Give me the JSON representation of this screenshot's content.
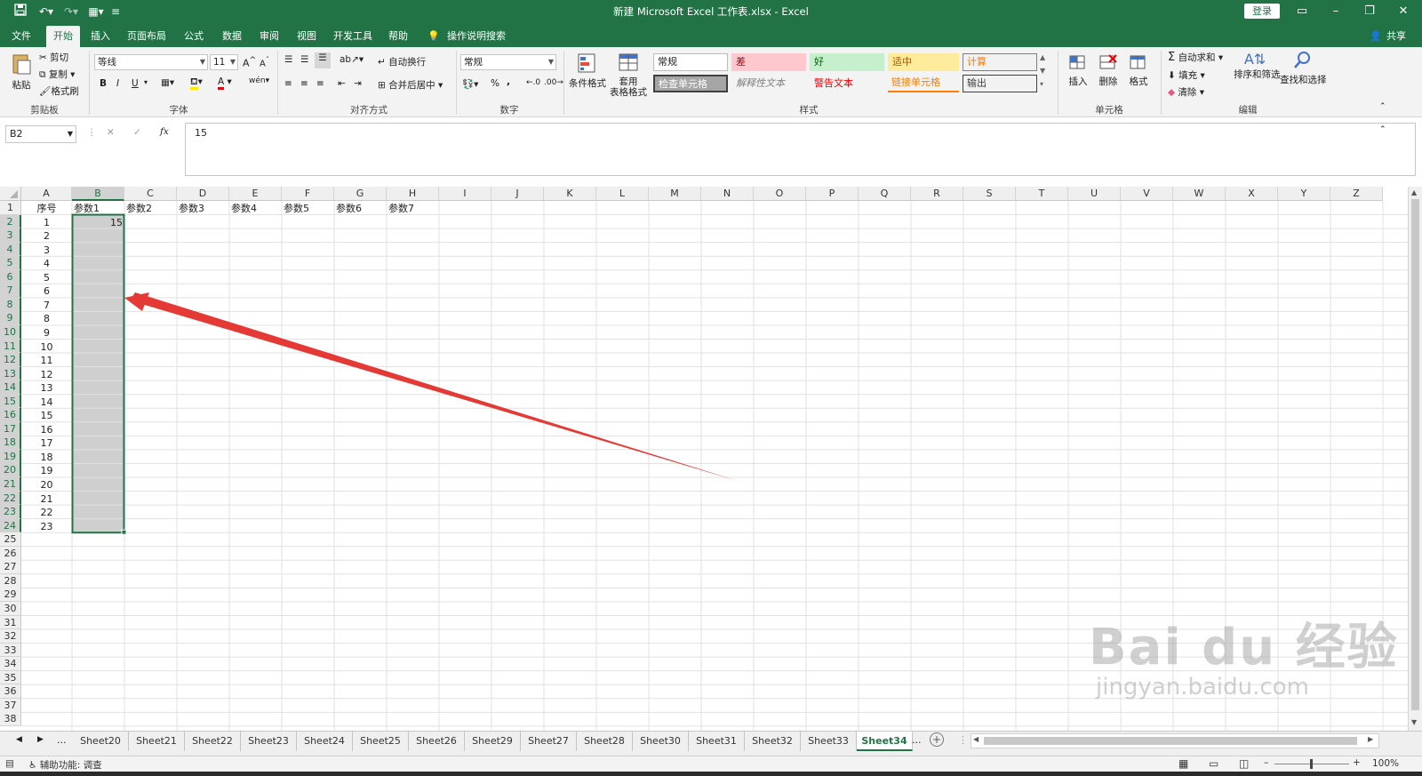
{
  "titlebar": {
    "title": "新建 Microsoft Excel 工作表.xlsx  -  Excel",
    "login": "登录",
    "quick_access": [
      "save-icon",
      "undo-icon",
      "redo-icon",
      "form-icon",
      "customize-icon"
    ]
  },
  "tabs": [
    "文件",
    "开始",
    "插入",
    "页面布局",
    "公式",
    "数据",
    "审阅",
    "视图",
    "开发工具",
    "帮助",
    "操作说明搜索"
  ],
  "active_tab": "开始",
  "share": "共享",
  "ribbon": {
    "clipboard": {
      "paste": "粘贴",
      "cut": "剪切",
      "copy": "复制",
      "format_painter": "格式刷",
      "label": "剪贴板"
    },
    "font": {
      "name": "等线",
      "size": "11",
      "bold": "B",
      "italic": "I",
      "underline": "U",
      "font_color": "A",
      "phonetic": "wén",
      "label": "字体"
    },
    "alignment": {
      "wrap": "自动换行",
      "merge": "合并后居中",
      "label": "对齐方式"
    },
    "number": {
      "format": "常规",
      "percent": "%",
      "comma": ",",
      "label": "数字"
    },
    "styles": {
      "conditional": "条件格式",
      "table_1": "套用",
      "table_2": "表格格式",
      "cells": [
        "常规",
        "差",
        "好",
        "适中",
        "计算",
        "检查单元格",
        "解释性文本",
        "警告文本",
        "链接单元格",
        "输出"
      ],
      "label": "样式"
    },
    "cells_group": {
      "insert": "插入",
      "delete": "删除",
      "format": "格式",
      "label": "单元格"
    },
    "editing": {
      "autosum": "自动求和",
      "fill": "填充",
      "clear": "清除",
      "sort": "排序和筛选",
      "find": "查找和选择",
      "label": "编辑"
    }
  },
  "formula_bar": {
    "name_box": "B2",
    "fx": "fx",
    "value": "15"
  },
  "columns": [
    "A",
    "B",
    "C",
    "D",
    "E",
    "F",
    "G",
    "H",
    "I",
    "J",
    "K",
    "L",
    "M",
    "N",
    "O",
    "P",
    "Q",
    "R",
    "S",
    "T",
    "U",
    "V",
    "W",
    "X",
    "Y",
    "Z"
  ],
  "rows": [
    "1",
    "2",
    "3",
    "4",
    "5",
    "6",
    "7",
    "8",
    "9",
    "10",
    "11",
    "12",
    "13",
    "14",
    "15",
    "16",
    "17",
    "18",
    "19",
    "20",
    "21",
    "22",
    "23",
    "24",
    "25",
    "26",
    "27",
    "28",
    "29",
    "30",
    "31",
    "32",
    "33",
    "34",
    "35",
    "36",
    "37",
    "38"
  ],
  "header_row": [
    "序号",
    "参数1",
    "参数2",
    "参数3",
    "参数4",
    "参数5",
    "参数6",
    "参数7"
  ],
  "col_a_values": [
    "1",
    "2",
    "3",
    "4",
    "5",
    "6",
    "7",
    "8",
    "9",
    "10",
    "11",
    "12",
    "13",
    "14",
    "15",
    "16",
    "17",
    "18",
    "19",
    "20",
    "21",
    "22",
    "23"
  ],
  "b2_value": "15",
  "sheets": [
    "Sheet20",
    "Sheet21",
    "Sheet22",
    "Sheet23",
    "Sheet24",
    "Sheet25",
    "Sheet26",
    "Sheet29",
    "Sheet27",
    "Sheet28",
    "Sheet30",
    "Sheet31",
    "Sheet32",
    "Sheet33",
    "Sheet34"
  ],
  "active_sheet": "Sheet34",
  "sheet_nav_ellipsis": "...",
  "status": {
    "accessibility": "辅助功能: 调查",
    "zoom": "100%"
  },
  "watermark": {
    "logo": "Bai du 经验",
    "url": "jingyan.baidu.com"
  },
  "arrow_color": "#e53935",
  "accent": "#217346"
}
